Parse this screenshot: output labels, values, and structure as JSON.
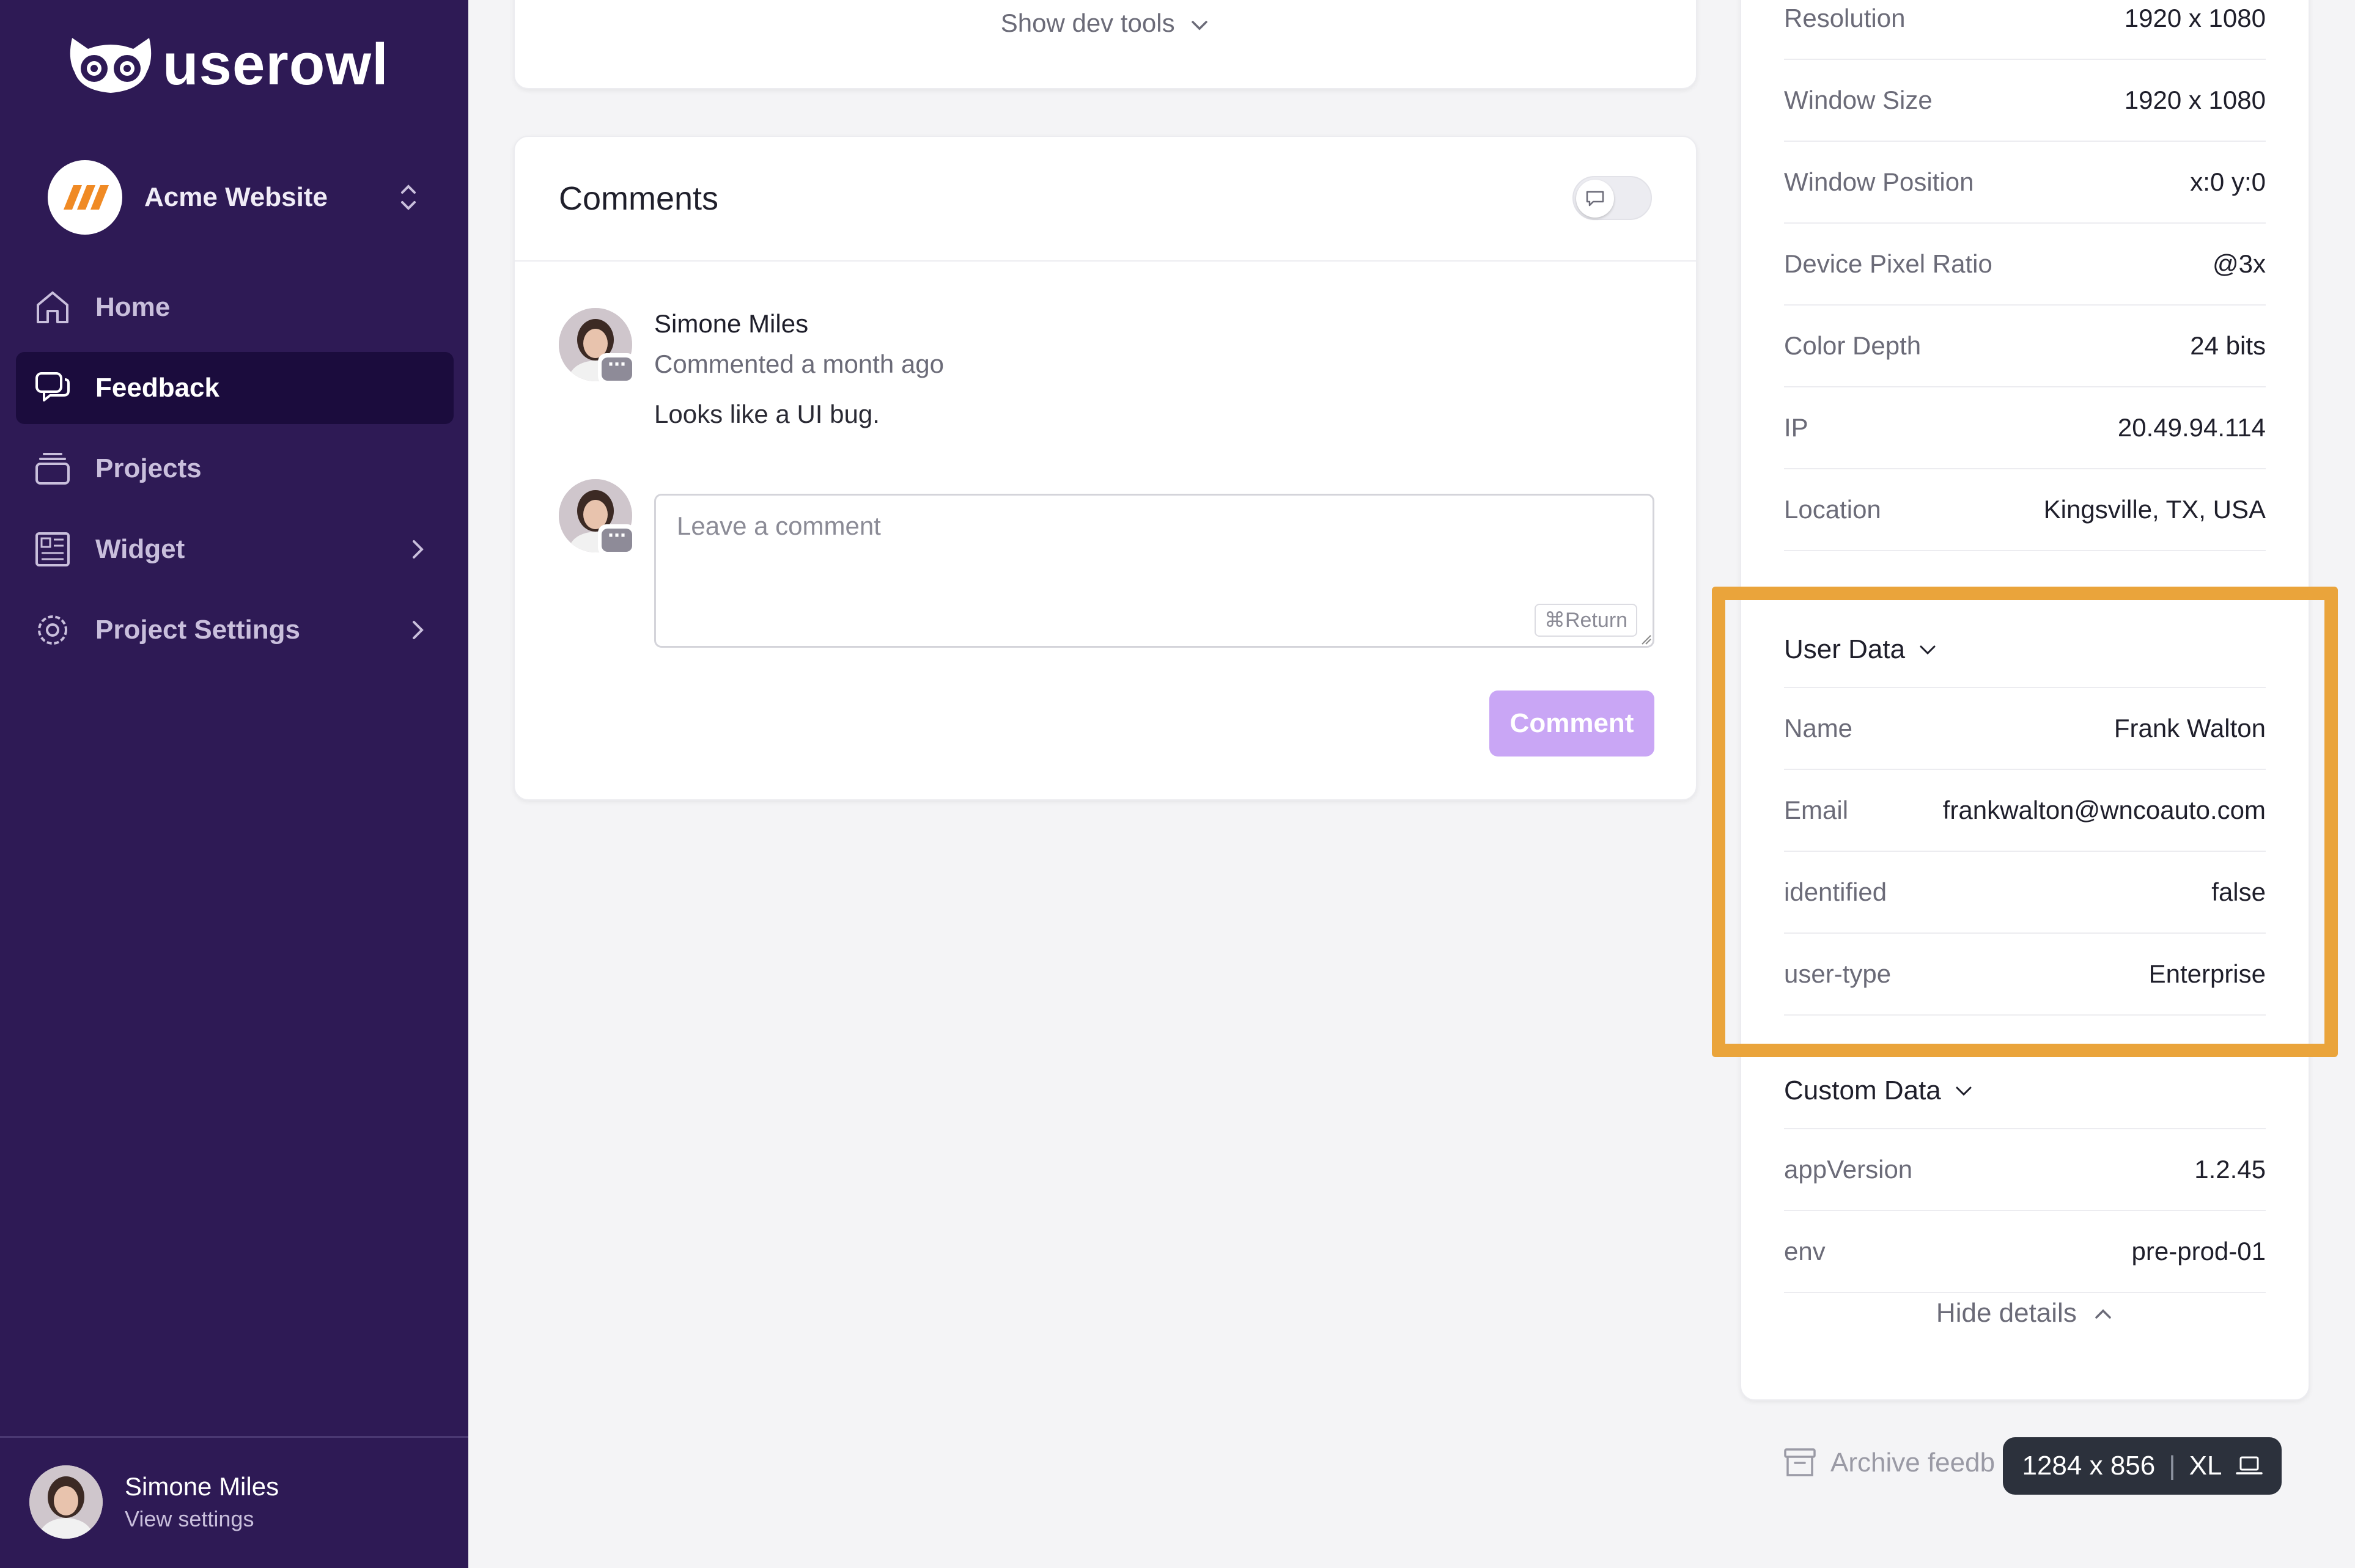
{
  "brand": {
    "name": "userowl",
    "accent": "#2e1a55",
    "logo_orange": "#f08a24"
  },
  "project_switcher": {
    "name": "Acme Website"
  },
  "nav": {
    "items": [
      {
        "label": "Home",
        "icon": "home-icon"
      },
      {
        "label": "Feedback",
        "icon": "feedback-icon",
        "active": true
      },
      {
        "label": "Projects",
        "icon": "projects-icon"
      },
      {
        "label": "Widget",
        "icon": "widget-icon",
        "has_submenu": true
      },
      {
        "label": "Project Settings",
        "icon": "gear-icon",
        "has_submenu": true
      }
    ]
  },
  "profile": {
    "name": "Simone Miles",
    "sub": "View settings"
  },
  "devtools": {
    "label": "Show dev tools"
  },
  "comments": {
    "title": "Comments",
    "items": [
      {
        "author": "Simone Miles",
        "meta": "Commented a month ago",
        "text": "Looks like a UI bug."
      }
    ],
    "input_placeholder": "Leave a comment",
    "shortcut_hint": "⌘Return",
    "submit_label": "Comment"
  },
  "details": {
    "system": [
      {
        "key": "Resolution",
        "value": "1920 x 1080"
      },
      {
        "key": "Window Size",
        "value": "1920 x 1080"
      },
      {
        "key": "Window Position",
        "value": "x:0 y:0"
      },
      {
        "key": "Device Pixel Ratio",
        "value": "@3x"
      },
      {
        "key": "Color Depth",
        "value": "24 bits"
      },
      {
        "key": "IP",
        "value": "20.49.94.114"
      },
      {
        "key": "Location",
        "value": "Kingsville, TX, USA"
      }
    ],
    "user_data_title": "User Data",
    "user_data": [
      {
        "key": "Name",
        "value": "Frank Walton"
      },
      {
        "key": "Email",
        "value": "frankwalton@wncoauto.com"
      },
      {
        "key": "identified",
        "value": "false"
      },
      {
        "key": "user-type",
        "value": "Enterprise"
      }
    ],
    "custom_data_title": "Custom Data",
    "custom_data": [
      {
        "key": "appVersion",
        "value": "1.2.45"
      },
      {
        "key": "env",
        "value": "pre-prod-01"
      }
    ],
    "hide_label": "Hide details"
  },
  "archive": {
    "label": "Archive feedb"
  },
  "viewport_badge": {
    "size": "1284 x 856",
    "breakpoint": "XL"
  },
  "highlight_color": "#eaa43b"
}
